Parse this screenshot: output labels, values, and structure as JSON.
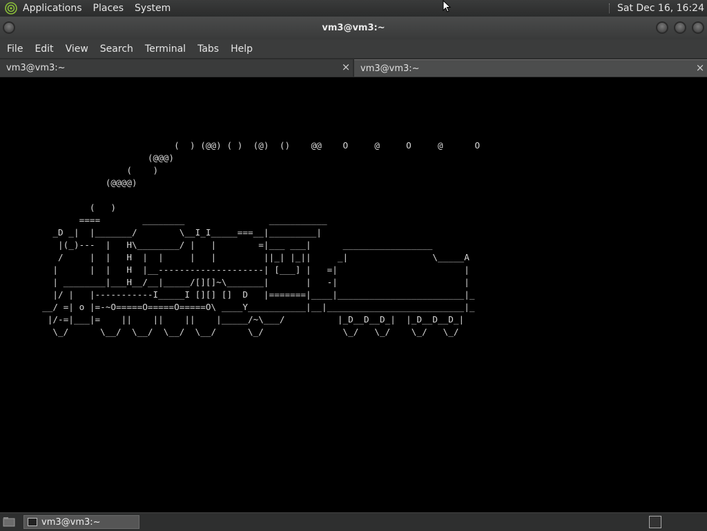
{
  "top_panel": {
    "menus": [
      "Applications",
      "Places",
      "System"
    ],
    "clock": "Sat Dec 16, 16:24"
  },
  "window": {
    "title": "vm3@vm3:~"
  },
  "menubar": {
    "items": [
      "File",
      "Edit",
      "View",
      "Search",
      "Terminal",
      "Tabs",
      "Help"
    ]
  },
  "tabs": [
    {
      "label": "vm3@vm3:~",
      "close": "×"
    },
    {
      "label": "vm3@vm3:~",
      "close": "×"
    }
  ],
  "terminal": {
    "content": "\n\n\n\n\n                                 (  ) (@@) ( )  (@)  ()    @@    O     @     O     @      O\n                            (@@@)\n                        (    )\n                    (@@@@)\n\n                 (   )\n               ====        ________                ___________\n          _D _|  |_______/        \\__I_I_____===__|_________|\n           |(_)---  |   H\\________/ |   |        =|___ ___|      _________________\n           /     |  |   H  |  |     |   |         ||_| |_||     _|                \\_____A\n          |      |  |   H  |__--------------------| [___] |   =|                        |\n          | ________|___H__/__|_____/[][]~\\_______|       |   -|                        |\n          |/ |   |-----------I_____I [][] []  D   |=======|____|________________________|_\n        __/ =| o |=-~O=====O=====O=====O\\ ____Y___________|__|__________________________|_\n         |/-=|___|=    ||    ||    ||    |_____/~\\___/          |_D__D__D_|  |_D__D__D_|\n          \\_/      \\__/  \\__/  \\__/  \\__/      \\_/               \\_/   \\_/    \\_/   \\_/"
  },
  "taskbar": {
    "task_label": "vm3@vm3:~"
  }
}
